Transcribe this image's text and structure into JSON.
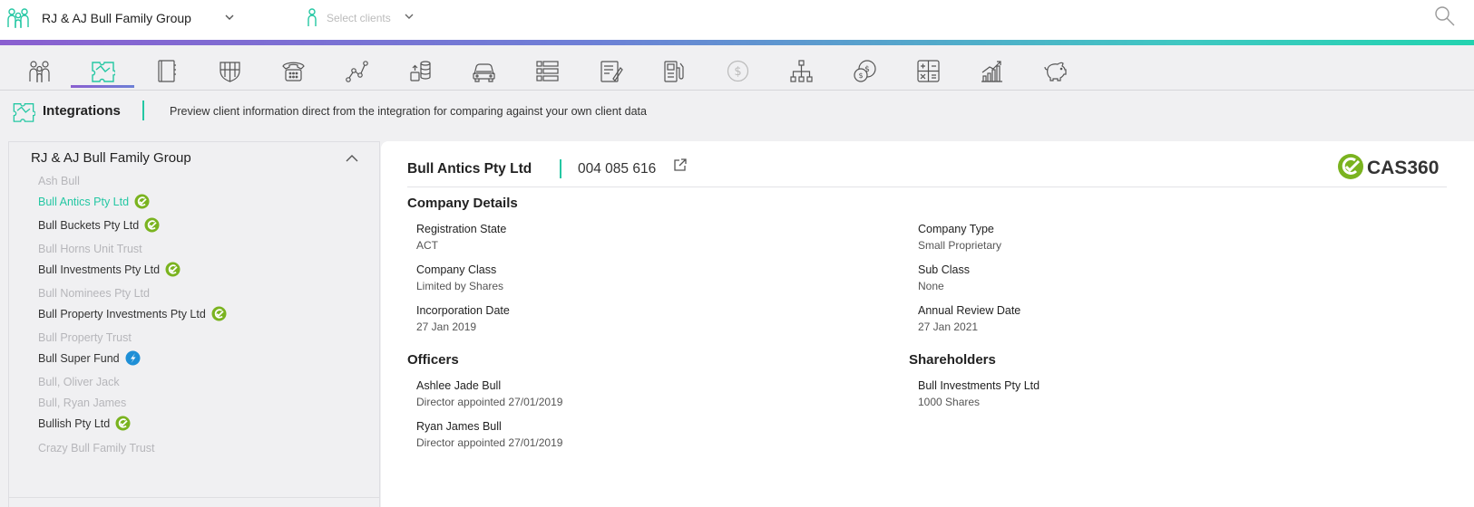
{
  "header": {
    "group_name": "RJ & AJ Bull Family Group",
    "client_placeholder": "Select clients",
    "icons": [
      "group-icon",
      "chevron-down-icon",
      "person-icon",
      "search-icon"
    ]
  },
  "nav": {
    "active_index": 1,
    "icons": [
      "family-icon",
      "integrations-icon",
      "contacts-book-icon",
      "insurance-shield-icon",
      "phone-icon",
      "network-graph-icon",
      "assets-stack-icon",
      "car-icon",
      "list-icon",
      "documents-icon",
      "fuel-icon",
      "dollar-coin-icon",
      "hierarchy-icon",
      "currency-exchange-icon",
      "calculator-icon",
      "bar-growth-icon",
      "piggy-bank-icon"
    ]
  },
  "section": {
    "title": "Integrations",
    "description": "Preview client information direct from the integration for comparing against your own client data"
  },
  "left_panel": {
    "title": "RJ & AJ Bull Family Group",
    "entities": [
      {
        "name": "Ash Bull",
        "state": "dim",
        "badge": ""
      },
      {
        "name": "Bull Antics Pty Ltd",
        "state": "active",
        "badge": "cas360-check-icon"
      },
      {
        "name": "Bull Buckets Pty Ltd",
        "state": "normal",
        "badge": "cas360-check-icon"
      },
      {
        "name": "Bull Horns Unit Trust",
        "state": "dim",
        "badge": ""
      },
      {
        "name": "Bull Investments Pty Ltd",
        "state": "normal",
        "badge": "cas360-check-icon"
      },
      {
        "name": "Bull Nominees Pty Ltd",
        "state": "dim",
        "badge": ""
      },
      {
        "name": "Bull Property Investments Pty Ltd",
        "state": "normal",
        "badge": "cas360-check-icon"
      },
      {
        "name": "Bull Property Trust",
        "state": "dim",
        "badge": ""
      },
      {
        "name": "Bull Super Fund",
        "state": "normal",
        "badge": "superfund-integration-icon"
      },
      {
        "name": "Bull, Oliver Jack",
        "state": "dim",
        "badge": ""
      },
      {
        "name": "Bull, Ryan James",
        "state": "dim",
        "badge": ""
      },
      {
        "name": "Bullish Pty Ltd",
        "state": "normal",
        "badge": "cas360-check-icon"
      },
      {
        "name": "Crazy Bull Family Trust",
        "state": "dim",
        "badge": ""
      }
    ]
  },
  "company": {
    "name": "Bull Antics Pty Ltd",
    "acn": "004 085 616",
    "logo_text": "CAS360",
    "details_heading": "Company Details",
    "fields": {
      "registration_state": {
        "label": "Registration State",
        "value": "ACT"
      },
      "company_type": {
        "label": "Company Type",
        "value": "Small Proprietary"
      },
      "company_class": {
        "label": "Company Class",
        "value": "Limited by Shares"
      },
      "sub_class": {
        "label": "Sub Class",
        "value": "None"
      },
      "incorporation_date": {
        "label": "Incorporation Date",
        "value": "27 Jan 2019"
      },
      "annual_review_date": {
        "label": "Annual Review Date",
        "value": "27 Jan 2021"
      }
    },
    "officers_heading": "Officers",
    "officers": [
      {
        "name": "Ashlee Jade Bull",
        "role": "Director appointed 27/01/2019"
      },
      {
        "name": "Ryan James Bull",
        "role": "Director appointed 27/01/2019"
      }
    ],
    "shareholders_heading": "Shareholders",
    "shareholders": [
      {
        "name": "Bull Investments Pty Ltd",
        "shares": "1000 Shares"
      }
    ]
  },
  "colors": {
    "accent": "#24c7a3",
    "badge_green": "#7ab31f",
    "badge_blue": "#1e8fd6",
    "gradient_start": "#8a5fd0",
    "gradient_end": "#23d3b0"
  }
}
